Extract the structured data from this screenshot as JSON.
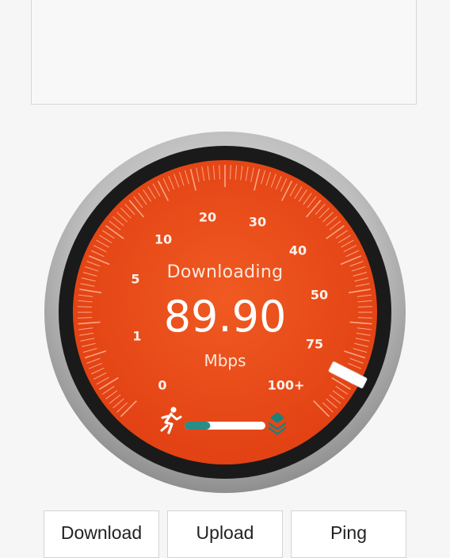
{
  "status_label": "Downloading",
  "speed_value": "89.90",
  "speed_unit": "Mbps",
  "progress_fraction": 0.2,
  "accent_color": "#e8471a",
  "progress_color": "#2a8c86",
  "scale_labels": [
    "0",
    "1",
    "5",
    "10",
    "20",
    "30",
    "40",
    "50",
    "75",
    "100+"
  ],
  "icons": {
    "left": "runner-icon",
    "right": "layers-icon"
  },
  "tabs": {
    "download": "Download",
    "upload": "Upload",
    "ping": "Ping"
  }
}
